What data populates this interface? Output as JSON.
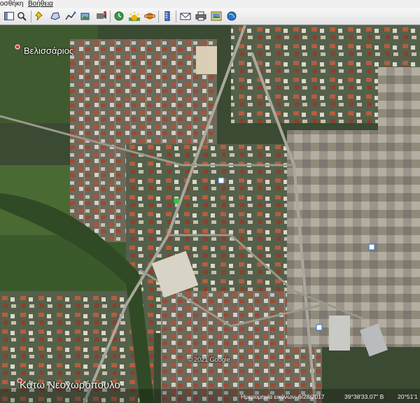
{
  "menu": {
    "item1": "οσθήκη",
    "item2": "Βοήθεια"
  },
  "toolbar": {
    "buttons": [
      "sidebar-toggle",
      "search",
      "placemark",
      "polygon",
      "path",
      "overlay",
      "tour",
      "historical",
      "sun",
      "planets",
      "ruler",
      "email",
      "print",
      "save-image",
      "maps"
    ]
  },
  "map": {
    "labels": {
      "top_left": "Βελισσάριος",
      "bottom_left": "Κάτω Νεοχωρόπουλο"
    },
    "copyright": "© 2021 Google",
    "status": {
      "imagery_date": "Ημερομηνία εικόνων: 6/28/2017",
      "latitude": "39°38'33.07\" Β",
      "longitude": "20°51'1"
    }
  },
  "colors": {
    "accent": "#2b72d6"
  }
}
